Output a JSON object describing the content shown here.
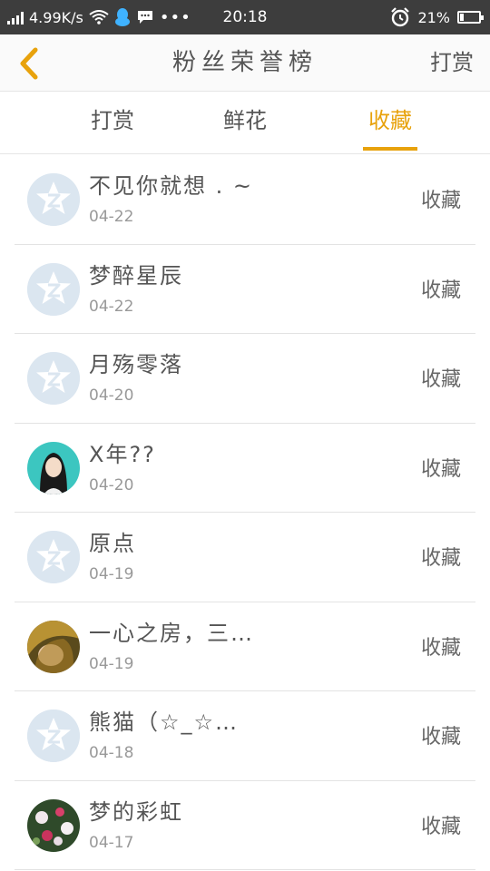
{
  "status_bar": {
    "speed": "4.99K/s",
    "time": "20:18",
    "battery": "21%",
    "battery_level": 0.21
  },
  "header": {
    "title": "粉丝荣誉榜",
    "right_label": "打赏"
  },
  "tabs": [
    {
      "label": "打赏",
      "active": false
    },
    {
      "label": "鲜花",
      "active": false
    },
    {
      "label": "收藏",
      "active": true
    }
  ],
  "rows": [
    {
      "name": "不见你就想 . ~",
      "date": "04-22",
      "action": "收藏",
      "avatar": "default-avatar-icon"
    },
    {
      "name": "梦醉星辰",
      "date": "04-22",
      "action": "收藏",
      "avatar": "default-avatar-icon"
    },
    {
      "name": "月殇零落",
      "date": "04-20",
      "action": "收藏",
      "avatar": "default-avatar-icon"
    },
    {
      "name": "X年??",
      "date": "04-20",
      "action": "收藏",
      "avatar": "photo-girl-avatar"
    },
    {
      "name": "原点",
      "date": "04-19",
      "action": "收藏",
      "avatar": "default-avatar-icon"
    },
    {
      "name": "一心之房，三…",
      "date": "04-19",
      "action": "收藏",
      "avatar": "photo-hair-avatar"
    },
    {
      "name": "熊猫（☆_☆…",
      "date": "04-18",
      "action": "收藏",
      "avatar": "default-avatar-icon"
    },
    {
      "name": "梦的彩虹",
      "date": "04-17",
      "action": "收藏",
      "avatar": "photo-flowers-avatar"
    }
  ],
  "colors": {
    "accent": "#e8a20c",
    "status_bar_bg": "#3d3d3d",
    "default_avatar_bg": "#dbe6f0"
  }
}
